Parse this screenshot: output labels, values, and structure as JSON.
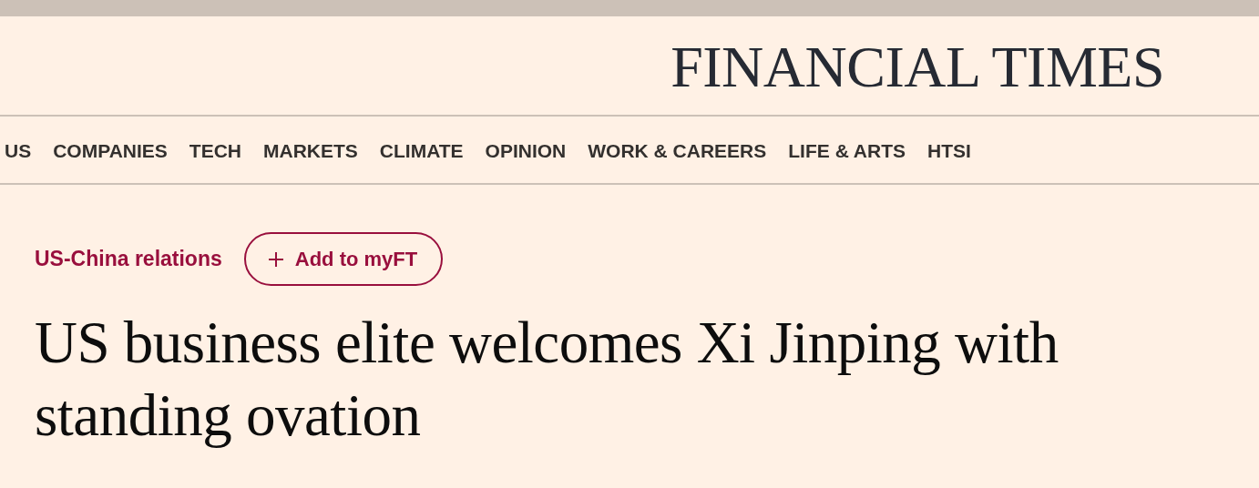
{
  "masthead": {
    "title": "FINANCIAL TIMES"
  },
  "nav": {
    "items": [
      {
        "label": "US"
      },
      {
        "label": "COMPANIES"
      },
      {
        "label": "TECH"
      },
      {
        "label": "MARKETS"
      },
      {
        "label": "CLIMATE"
      },
      {
        "label": "OPINION"
      },
      {
        "label": "WORK & CAREERS"
      },
      {
        "label": "LIFE & ARTS"
      },
      {
        "label": "HTSI"
      }
    ]
  },
  "article": {
    "topic": "US-China relations",
    "follow_button": "Add to myFT",
    "headline": "US business elite welcomes Xi Jinping with standing ovation"
  }
}
